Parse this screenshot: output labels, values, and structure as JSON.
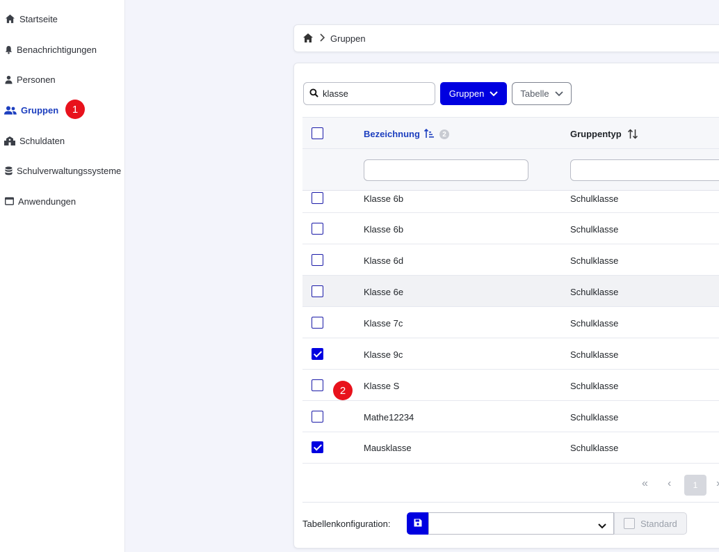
{
  "sidebar": {
    "items": [
      {
        "label": "Startseite",
        "icon": "home-icon"
      },
      {
        "label": "Benachrichtigungen",
        "icon": "bell-icon"
      },
      {
        "label": "Personen",
        "icon": "person-icon"
      },
      {
        "label": "Gruppen",
        "icon": "users-icon",
        "active": true
      },
      {
        "label": "Schuldaten",
        "icon": "school-icon"
      },
      {
        "label": "Schulverwaltungssysteme",
        "icon": "database-icon"
      },
      {
        "label": "Anwendungen",
        "icon": "window-icon"
      }
    ]
  },
  "annotations": {
    "one": "1",
    "two": "2"
  },
  "breadcrumb": {
    "current": "Gruppen"
  },
  "toolbar": {
    "search_value": "klasse",
    "gruppen_label": "Gruppen",
    "tabelle_label": "Tabelle"
  },
  "table": {
    "columns": [
      "Bezeichnung",
      "Gruppentyp"
    ],
    "sort_priority": "2",
    "rows": [
      {
        "name": "Klasse 6b",
        "type": "Schulklasse",
        "checked": false
      },
      {
        "name": "Klasse 6b",
        "type": "Schulklasse",
        "checked": false
      },
      {
        "name": "Klasse 6d",
        "type": "Schulklasse",
        "checked": false
      },
      {
        "name": "Klasse 6e",
        "type": "Schulklasse",
        "checked": false
      },
      {
        "name": "Klasse 7c",
        "type": "Schulklasse",
        "checked": false
      },
      {
        "name": "Klasse 9c",
        "type": "Schulklasse",
        "checked": true
      },
      {
        "name": "Klasse S",
        "type": "Schulklasse",
        "checked": false
      },
      {
        "name": "Mathe12234",
        "type": "Schulklasse",
        "checked": false
      },
      {
        "name": "Mausklasse",
        "type": "Schulklasse",
        "checked": true
      }
    ]
  },
  "pagination": {
    "first": "«",
    "prev": "‹",
    "current": "1",
    "next": "›"
  },
  "config": {
    "label": "Tabellenkonfiguration:",
    "standard_label": "Standard"
  },
  "colors": {
    "accent": "#0000e0",
    "active_nav": "#1d3fbf",
    "badge": "#e8121c"
  }
}
